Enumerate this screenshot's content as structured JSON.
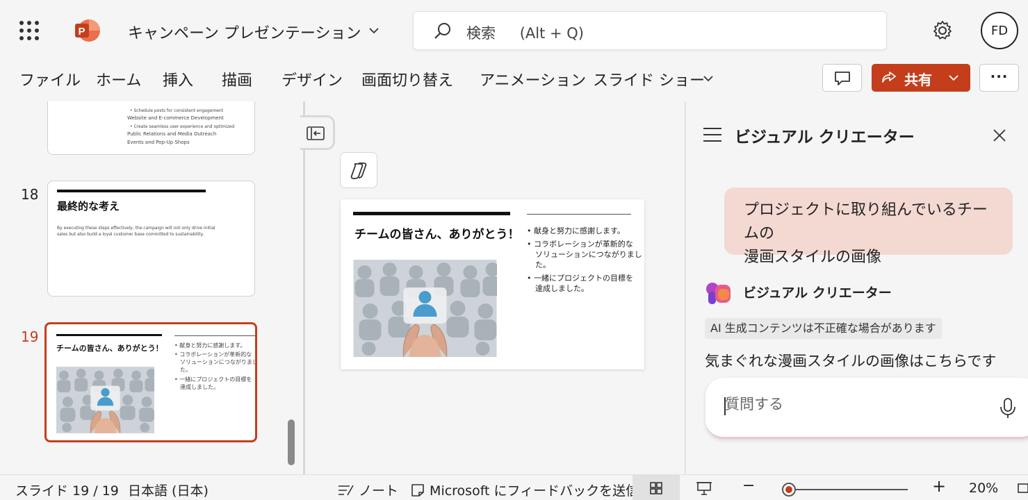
{
  "app": {
    "document_title": "キャンペーン プレゼンテーション",
    "brand_color": "#c43e1c",
    "search": {
      "label": "検索",
      "shortcut": "(Alt + Q)"
    },
    "user_initials": "FD"
  },
  "ribbon": {
    "tabs": [
      "ファイル",
      "ホーム",
      "挿入",
      "描画",
      "デザイン",
      "画面切り替え",
      "アニメーション",
      "スライド ショー"
    ],
    "share_label": "共有"
  },
  "thumbnails": {
    "slide17": {
      "lines": [
        "Schedule posts for consistent engagement",
        "Website and E-commerce Development",
        "Create seamless user experience and optimized",
        "Public Relations and Media Outreach",
        "Events and Pop-Up Shops"
      ]
    },
    "slide18": {
      "number": "18",
      "title": "最終的な考え",
      "body_line1": "By executing these steps effectively, the campaign will not only drive initial",
      "body_line2": "sales but also build a loyal customer base committed to sustainability."
    },
    "slide19": {
      "number": "19",
      "title": "チームの皆さん、ありがとう！",
      "bullet1": "献身と努力に感謝します。",
      "bullet2a": "コラボレーションが革新的な",
      "bullet2b": "ソリューションにつながりまし",
      "bullet2c": "た。",
      "bullet3a": "一緒にプロジェクトの目標を",
      "bullet3b": "達成しました。"
    }
  },
  "slide": {
    "title": "チームの皆さん、ありがとう！",
    "bullet1": "献身と努力に感謝します。",
    "bullet2a": "コラボレーションが革新的な",
    "bullet2b": "ソリューションにつながりまし",
    "bullet2c": "た。",
    "bullet3a": "一緒にプロジェクトの目標を",
    "bullet3b": "達成しました。"
  },
  "panel": {
    "title": "ビジュアル クリエーター",
    "user_line1": "プロジェクトに取り組んでいるチームの",
    "user_line2": "漫画スタイルの画像",
    "assistant_name": "ビジュアル クリエーター",
    "ai_disclaimer": "AI 生成コンテンツは不正確な場合があります",
    "assistant_message": "気まぐれな漫画スタイルの画像はこちらです",
    "ask_placeholder": "質問する"
  },
  "status": {
    "slide_counter": "スライド 19 / 19",
    "language": "日本語 (日本)",
    "notes_label": "ノート",
    "feedback_label": "Microsoft にフィードバックを送信",
    "zoom_minus": "−",
    "zoom_plus": "+",
    "zoom_level": "20%",
    "zoom_fraction": 0.03
  }
}
